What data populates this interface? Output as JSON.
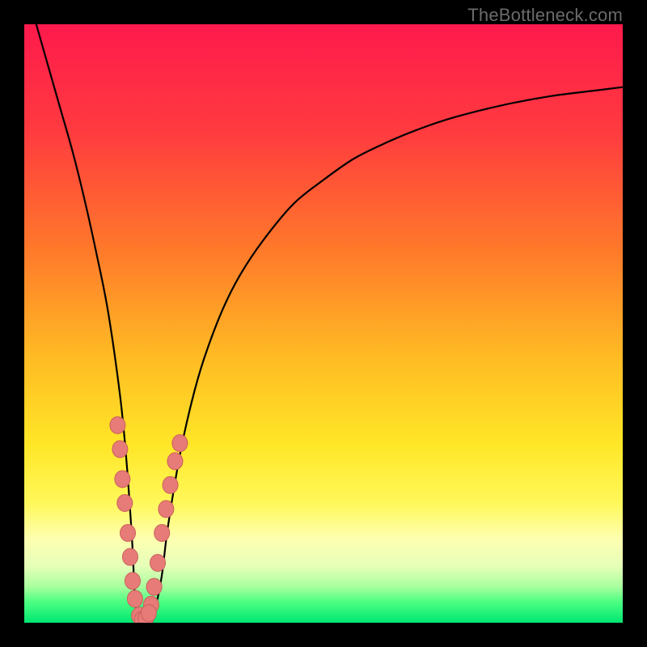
{
  "watermark": "TheBottleneck.com",
  "colors": {
    "frame": "#000000",
    "curve": "#000000",
    "dot_fill": "#e77b77",
    "dot_stroke": "#c9605c",
    "gradient_stops": [
      {
        "offset": 0.0,
        "color": "#ff1a4d"
      },
      {
        "offset": 0.18,
        "color": "#ff3b3f"
      },
      {
        "offset": 0.38,
        "color": "#ff7a2a"
      },
      {
        "offset": 0.55,
        "color": "#ffb924"
      },
      {
        "offset": 0.7,
        "color": "#ffe626"
      },
      {
        "offset": 0.8,
        "color": "#fff85a"
      },
      {
        "offset": 0.86,
        "color": "#fdffb0"
      },
      {
        "offset": 0.905,
        "color": "#e6ffb8"
      },
      {
        "offset": 0.94,
        "color": "#a8ff9e"
      },
      {
        "offset": 0.965,
        "color": "#4dff82"
      },
      {
        "offset": 1.0,
        "color": "#00e671"
      }
    ]
  },
  "chart_data": {
    "type": "line",
    "title": "",
    "xlabel": "",
    "ylabel": "",
    "xlim": [
      0,
      100
    ],
    "ylim": [
      0,
      100
    ],
    "series": [
      {
        "name": "bottleneck-curve",
        "x": [
          2,
          4,
          6,
          8,
          10,
          12,
          14,
          16,
          17,
          18,
          18.5,
          19,
          20,
          21,
          22,
          23,
          24,
          26,
          28,
          30,
          33,
          36,
          40,
          45,
          50,
          55,
          60,
          66,
          72,
          80,
          88,
          96,
          100
        ],
        "values": [
          100,
          93,
          86,
          79,
          71,
          62,
          52,
          38,
          28,
          14,
          4,
          1,
          0,
          1,
          3,
          8,
          16,
          28,
          37,
          44,
          52,
          58,
          64,
          70,
          74,
          77.5,
          80,
          82.5,
          84.5,
          86.5,
          88,
          89,
          89.5
        ]
      }
    ],
    "scatter": [
      {
        "name": "left-branch-dots",
        "points": [
          {
            "x": 15.6,
            "y": 33
          },
          {
            "x": 16.0,
            "y": 29
          },
          {
            "x": 16.4,
            "y": 24
          },
          {
            "x": 16.8,
            "y": 20
          },
          {
            "x": 17.3,
            "y": 15
          },
          {
            "x": 17.7,
            "y": 11
          },
          {
            "x": 18.1,
            "y": 7
          },
          {
            "x": 18.5,
            "y": 4
          }
        ]
      },
      {
        "name": "right-branch-dots",
        "points": [
          {
            "x": 21.2,
            "y": 3
          },
          {
            "x": 21.7,
            "y": 6
          },
          {
            "x": 22.3,
            "y": 10
          },
          {
            "x": 23.0,
            "y": 15
          },
          {
            "x": 23.7,
            "y": 19
          },
          {
            "x": 24.4,
            "y": 23
          },
          {
            "x": 25.2,
            "y": 27
          },
          {
            "x": 26.0,
            "y": 30
          }
        ]
      },
      {
        "name": "vertex-dots",
        "points": [
          {
            "x": 19.2,
            "y": 1.2
          },
          {
            "x": 19.7,
            "y": 0.5
          },
          {
            "x": 20.3,
            "y": 0.7
          },
          {
            "x": 20.8,
            "y": 1.6
          }
        ]
      }
    ]
  }
}
